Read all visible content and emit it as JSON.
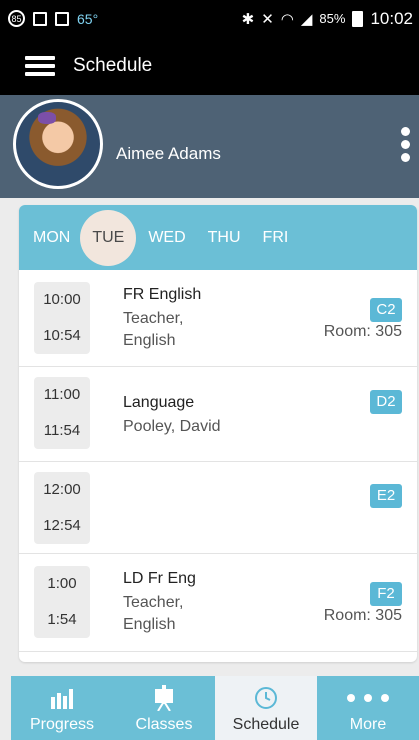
{
  "status_bar": {
    "badge": "85",
    "temperature": "65°",
    "battery": "85%",
    "time": "10:02"
  },
  "app_bar": {
    "title": "Schedule"
  },
  "profile": {
    "name": "Aimee Adams"
  },
  "days": [
    {
      "label": "MON",
      "selected": false
    },
    {
      "label": "TUE",
      "selected": true
    },
    {
      "label": "WED",
      "selected": false
    },
    {
      "label": "THU",
      "selected": false
    },
    {
      "label": "FRI",
      "selected": false
    }
  ],
  "schedule": [
    {
      "start": "10:00",
      "end": "10:54",
      "subject": "FR English",
      "teacher_line1": "Teacher,",
      "teacher_line2": "English",
      "block": "C2",
      "room": "Room: 305"
    },
    {
      "start": "11:00",
      "end": "11:54",
      "subject": "Language",
      "teacher_line1": "Pooley, David",
      "teacher_line2": "",
      "block": "D2",
      "room": ""
    },
    {
      "start": "12:00",
      "end": "12:54",
      "subject": "",
      "teacher_line1": "",
      "teacher_line2": "",
      "block": "E2",
      "room": ""
    },
    {
      "start": "1:00",
      "end": "1:54",
      "subject": "LD Fr Eng",
      "teacher_line1": "Teacher,",
      "teacher_line2": "English",
      "block": "F2",
      "room": "Room: 305"
    }
  ],
  "nav": [
    {
      "label": "Progress",
      "icon": "progress-icon"
    },
    {
      "label": "Classes",
      "icon": "classes-icon"
    },
    {
      "label": "Schedule",
      "icon": "clock-icon"
    },
    {
      "label": "More",
      "icon": "more-dots-icon"
    }
  ],
  "colors": {
    "accent": "#6bbfd6",
    "badge": "#5bb8d6",
    "profile_bg": "#4e6275",
    "selected_day": "#f2e6dd"
  }
}
